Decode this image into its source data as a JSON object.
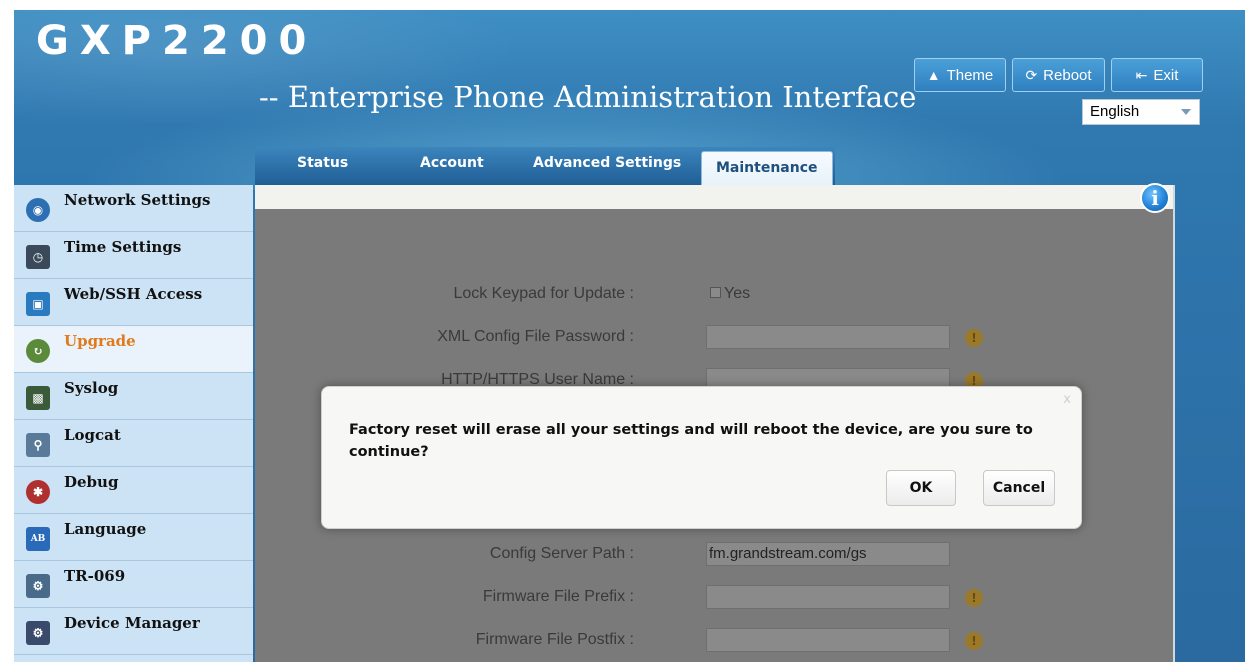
{
  "header": {
    "logo": "GXP2200",
    "subtitle": "-- Enterprise Phone Administration Interface",
    "buttons": [
      {
        "label": "Theme",
        "icon": "shirt-icon"
      },
      {
        "label": "Reboot",
        "icon": "refresh-icon"
      },
      {
        "label": "Exit",
        "icon": "exit-icon"
      }
    ],
    "language": {
      "selected": "English"
    }
  },
  "tabs": [
    {
      "label": "Status"
    },
    {
      "label": "Account"
    },
    {
      "label": "Advanced Settings"
    },
    {
      "label": "Maintenance",
      "active": true
    }
  ],
  "sidebar": {
    "items": [
      {
        "label": "Network Settings",
        "icon": "network-globe-icon",
        "color": "#2d6fb3"
      },
      {
        "label": "Time Settings",
        "icon": "clock-icon",
        "color": "#3a4a5a"
      },
      {
        "label": "Web/SSH Access",
        "icon": "computers-icon",
        "color": "#2a7abf"
      },
      {
        "label": "Upgrade",
        "icon": "upgrade-arrow-icon",
        "color": "#5a8a3a",
        "active": true
      },
      {
        "label": "Syslog",
        "icon": "syslog-monitor-icon",
        "color": "#3a5a3a"
      },
      {
        "label": "Logcat",
        "icon": "magnifier-icon",
        "color": "#5a7a9a"
      },
      {
        "label": "Debug",
        "icon": "bug-icon",
        "color": "#b03030"
      },
      {
        "label": "Language",
        "icon": "language-ab-icon",
        "color": "#2a6ab8"
      },
      {
        "label": "TR-069",
        "icon": "tr069-icon",
        "color": "#4a6a8a"
      },
      {
        "label": "Device Manager",
        "icon": "device-manager-icon",
        "color": "#3a4a6a"
      }
    ]
  },
  "form": {
    "lock_keypad": {
      "label": "Lock Keypad for Update :",
      "option": "Yes"
    },
    "xml_password": {
      "label": "XML Config File Password :",
      "value": ""
    },
    "http_user": {
      "label": "HTTP/HTTPS User Name :",
      "value": ""
    },
    "config_server_path": {
      "label": "Config Server Path :",
      "value": "fm.grandstream.com/gs"
    },
    "fw_prefix": {
      "label": "Firmware File Prefix :",
      "value": ""
    },
    "fw_postfix": {
      "label": "Firmware File Postfix :",
      "value": ""
    }
  },
  "dialog": {
    "message": "Factory reset will erase all your settings and will reboot the device, are you sure to continue?",
    "ok": "OK",
    "cancel": "Cancel",
    "close": "x"
  },
  "info_icon": "i"
}
